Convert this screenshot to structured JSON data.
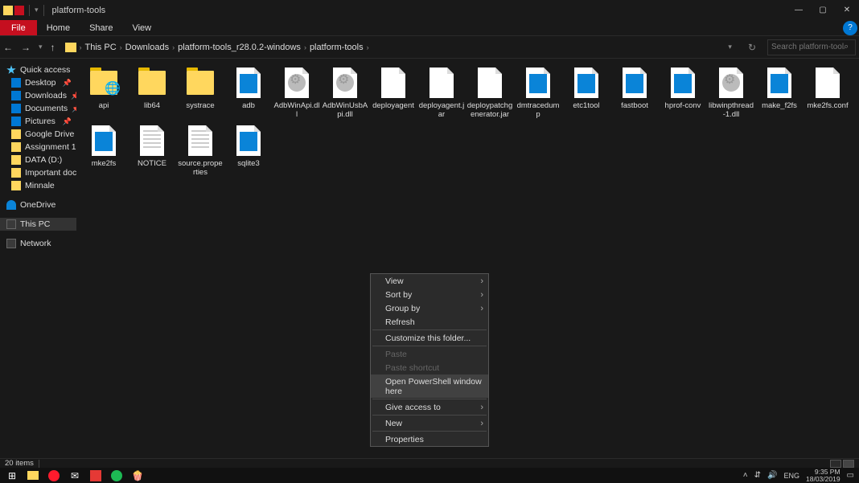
{
  "window": {
    "title": "platform-tools",
    "minimize": "—",
    "maximize": "▢",
    "close": "✕",
    "help": "?"
  },
  "ribbon": {
    "file": "File",
    "tabs": [
      "Home",
      "Share",
      "View"
    ]
  },
  "nav": {
    "back": "←",
    "forward": "→",
    "dropdown": "▾",
    "up": "↑",
    "refresh": "↻"
  },
  "breadcrumb": {
    "items": [
      "This PC",
      "Downloads",
      "platform-tools_r28.0.2-windows",
      "platform-tools"
    ]
  },
  "search": {
    "placeholder": "Search platform-tools",
    "icon": "⌕"
  },
  "sidebar": {
    "quick_access": "Quick access",
    "items": [
      {
        "label": "Desktop",
        "icon": "desktop",
        "pinned": true
      },
      {
        "label": "Downloads",
        "icon": "dl",
        "pinned": true
      },
      {
        "label": "Documents",
        "icon": "doc",
        "pinned": true
      },
      {
        "label": "Pictures",
        "icon": "pic",
        "pinned": true
      },
      {
        "label": "Google Drive",
        "icon": "folder",
        "pinned": true
      },
      {
        "label": "Assignment 1",
        "icon": "folder",
        "pinned": false
      },
      {
        "label": "DATA (D:)",
        "icon": "folder",
        "pinned": false
      },
      {
        "label": "Important documen",
        "icon": "folder",
        "pinned": false
      },
      {
        "label": "Minnale",
        "icon": "folder",
        "pinned": false
      }
    ],
    "onedrive": "OneDrive",
    "this_pc": "This PC",
    "network": "Network"
  },
  "files": [
    {
      "name": "api",
      "type": "folder-globe"
    },
    {
      "name": "lib64",
      "type": "folder"
    },
    {
      "name": "systrace",
      "type": "folder"
    },
    {
      "name": "adb",
      "type": "blue"
    },
    {
      "name": "AdbWinApi.dll",
      "type": "gear"
    },
    {
      "name": "AdbWinUsbApi.dll",
      "type": "gear"
    },
    {
      "name": "deployagent",
      "type": "blank"
    },
    {
      "name": "deployagent.jar",
      "type": "blank"
    },
    {
      "name": "deploypatchgenerator.jar",
      "type": "blank"
    },
    {
      "name": "dmtracedump",
      "type": "blue"
    },
    {
      "name": "etc1tool",
      "type": "blue"
    },
    {
      "name": "fastboot",
      "type": "blue"
    },
    {
      "name": "hprof-conv",
      "type": "blue"
    },
    {
      "name": "libwinpthread-1.dll",
      "type": "gear"
    },
    {
      "name": "make_f2fs",
      "type": "blue"
    },
    {
      "name": "mke2fs.conf",
      "type": "blank"
    },
    {
      "name": "mke2fs",
      "type": "blue"
    },
    {
      "name": "NOTICE",
      "type": "lines"
    },
    {
      "name": "source.properties",
      "type": "lines"
    },
    {
      "name": "sqlite3",
      "type": "blue"
    }
  ],
  "context_menu": {
    "items": [
      {
        "label": "View",
        "sub": true
      },
      {
        "label": "Sort by",
        "sub": true
      },
      {
        "label": "Group by",
        "sub": true
      },
      {
        "label": "Refresh"
      },
      {
        "sep": true
      },
      {
        "label": "Customize this folder..."
      },
      {
        "sep": true
      },
      {
        "label": "Paste",
        "disabled": true
      },
      {
        "label": "Paste shortcut",
        "disabled": true
      },
      {
        "label": "Open PowerShell window here",
        "highlighted": true
      },
      {
        "sep": true
      },
      {
        "label": "Give access to",
        "sub": true
      },
      {
        "sep": true
      },
      {
        "label": "New",
        "sub": true
      },
      {
        "sep": true
      },
      {
        "label": "Properties"
      }
    ]
  },
  "status": {
    "count": "20 items"
  },
  "taskbar": {
    "time": "9:35 PM",
    "date": "18/03/2019",
    "lang": "ENG",
    "icons": {
      "chevron": "˄",
      "wifi": "⇵",
      "volume": "🔊",
      "notif": "▭"
    }
  }
}
